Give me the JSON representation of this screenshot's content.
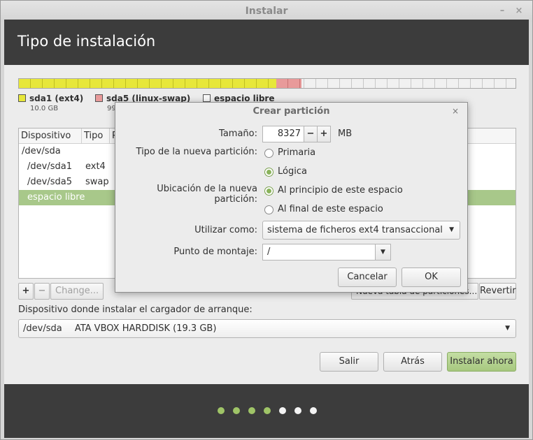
{
  "window": {
    "title": "Instalar",
    "minimize_label": "–",
    "close_label": "×"
  },
  "header": {
    "title": "Tipo de instalación"
  },
  "usage": {
    "legend": [
      {
        "label": "sda1 (ext4)",
        "size": "10.0 GB",
        "color": "#e7e73a"
      },
      {
        "label": "sda5 (linux-swap)",
        "size": "99",
        "color": "#e89a9a"
      },
      {
        "label": "espacio libre",
        "size": "",
        "color": "#f8f8f8"
      }
    ]
  },
  "table": {
    "headers": [
      "Dispositivo",
      "Tipo",
      "P"
    ],
    "rows": [
      {
        "device": "/dev/sda",
        "type": ""
      },
      {
        "device": "/dev/sda1",
        "type": "ext4"
      },
      {
        "device": "/dev/sda5",
        "type": "swap"
      },
      {
        "device": "espacio libre",
        "type": "",
        "selected": true
      }
    ]
  },
  "table_buttons": {
    "add": "+",
    "remove": "−",
    "change": "Change...",
    "new_table": "Nueva tabla de particiones...",
    "revert": "Revertir"
  },
  "bootloader": {
    "label": "Dispositivo donde instalar el cargador de arranque:",
    "device": "/dev/sda",
    "description": "ATA VBOX HARDDISK (19.3 GB)"
  },
  "actions": {
    "quit": "Salir",
    "back": "Atrás",
    "install": "Instalar ahora"
  },
  "progress": {
    "steps_total": 7,
    "steps_done": 4
  },
  "dialog": {
    "title": "Crear partición",
    "close": "×",
    "size_label": "Tamaño:",
    "size_value": "8327",
    "size_unit": "MB",
    "minus": "−",
    "plus": "+",
    "type_label": "Tipo de la nueva partición:",
    "type_primary": "Primaria",
    "type_logical": "Lógica",
    "type_selected": "Lógica",
    "location_label": "Ubicación de la nueva partición:",
    "location_start": "Al principio de este espacio",
    "location_end": "Al final de este espacio",
    "location_selected": "Al principio de este espacio",
    "use_as_label": "Utilizar como:",
    "use_as_value": "sistema de ficheros ext4 transaccional",
    "mount_label": "Punto de montaje:",
    "mount_value": "/",
    "cancel": "Cancelar",
    "ok": "OK"
  }
}
